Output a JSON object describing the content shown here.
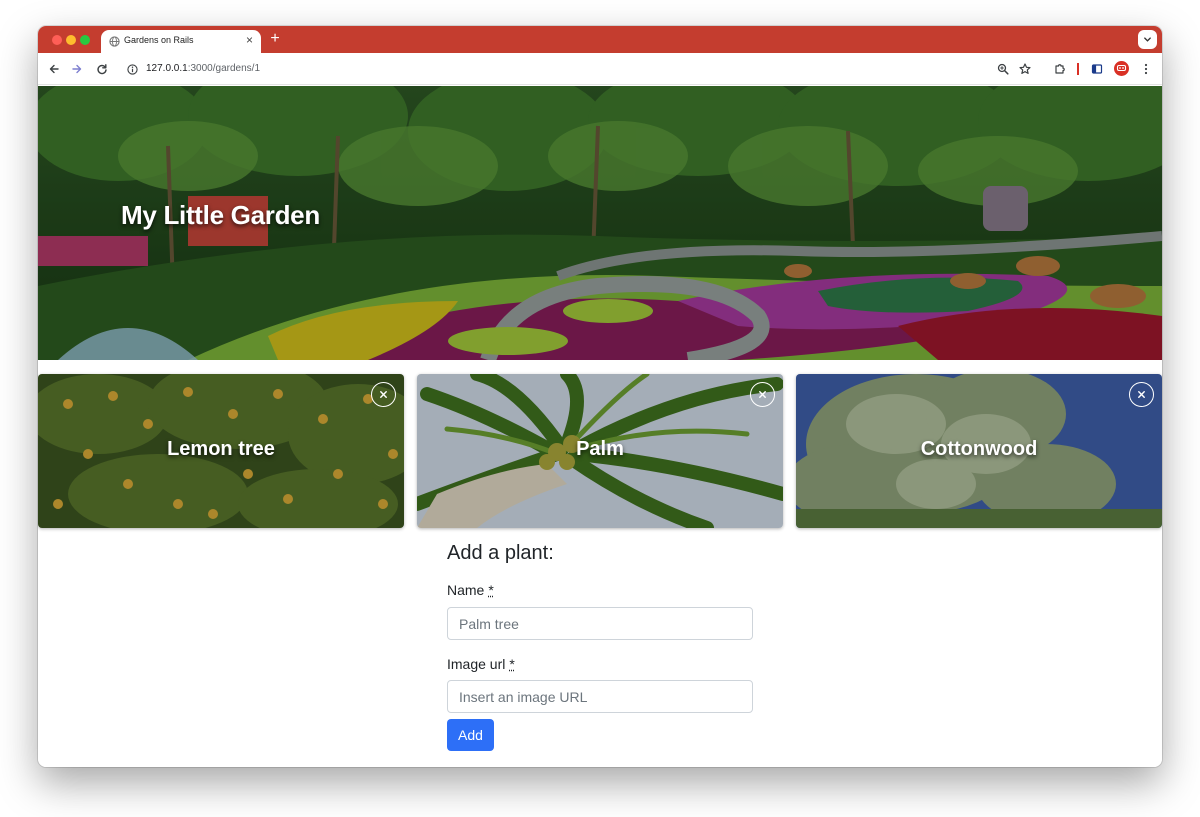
{
  "browser": {
    "tab_title": "Gardens on Rails",
    "new_tab_symbol": "+",
    "tab_close_symbol": "×",
    "url_host": "127.0.0.1",
    "url_path": ":3000/gardens/1",
    "accent_color": "#c43d2f"
  },
  "hero": {
    "title": "My Little Garden"
  },
  "plants": [
    {
      "name": "Lemon tree",
      "image": "lemon-tree-photo"
    },
    {
      "name": "Palm",
      "image": "palm-tree-photo"
    },
    {
      "name": "Cottonwood",
      "image": "cottonwood-tree-photo"
    }
  ],
  "form": {
    "heading": "Add a plant:",
    "name_label": "Name",
    "required_marker": "*",
    "name_placeholder": "Palm tree",
    "image_label": "Image url",
    "image_placeholder": "Insert an image URL",
    "submit_label": "Add",
    "submit_color": "#2d6ff7"
  }
}
